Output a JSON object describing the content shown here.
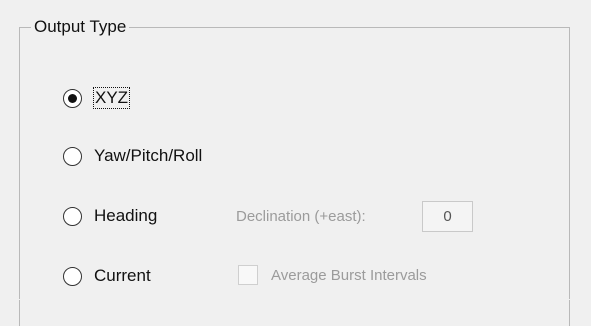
{
  "output_type": {
    "title": "Output Type",
    "options": [
      {
        "label": "XYZ",
        "selected": true,
        "focused": true
      },
      {
        "label": "Yaw/Pitch/Roll",
        "selected": false
      },
      {
        "label": "Heading",
        "selected": false
      },
      {
        "label": "Current",
        "selected": false
      }
    ],
    "declination": {
      "label": "Declination (+east):",
      "value": "0",
      "enabled": false
    },
    "average_burst_intervals": {
      "label": "Average Burst Intervals",
      "checked": false,
      "enabled": false
    }
  },
  "colors": {
    "window_background": "#f0f0f0",
    "group_border": "#b9b9b9",
    "text": "#111111",
    "disabled_text": "#9b9b9b",
    "input_border": "#c9c9c9"
  },
  "icons": {
    "selected_radio": "selected-radio-icon",
    "unselected_radio": "unselected-radio-icon",
    "checkbox": "unchecked-checkbox-icon"
  }
}
